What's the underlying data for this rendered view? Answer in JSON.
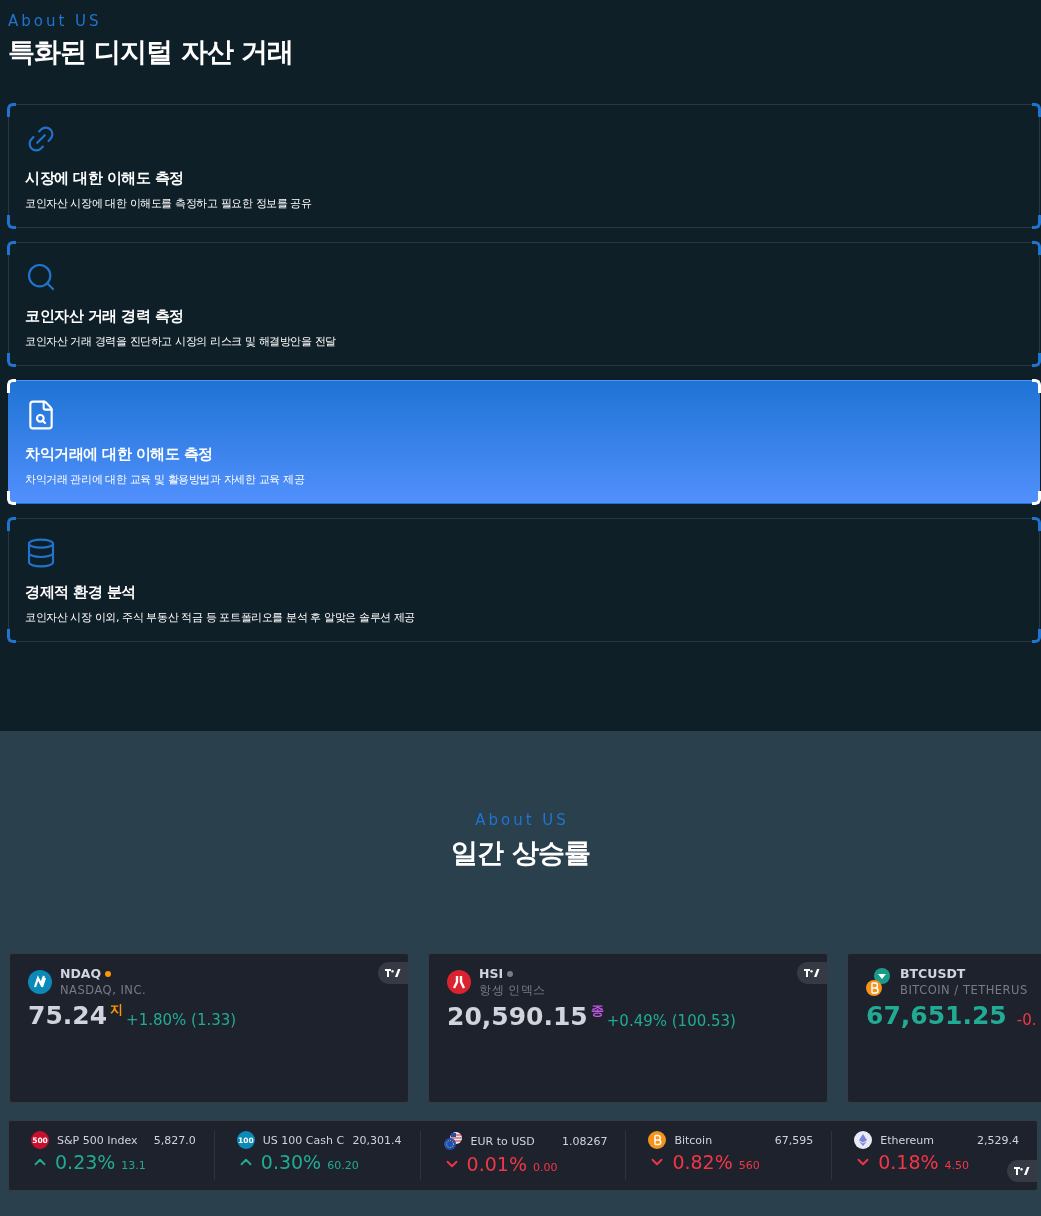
{
  "header": {
    "eyebrow": "About US",
    "title": "특화된 디지털 자산 거래"
  },
  "features": [
    {
      "kind": "link",
      "title": "시장에 대한 이해도 측정",
      "description": "코인자산 시장에 대한 이해도를 측정하고 필요한 정보를 공유",
      "selected": false
    },
    {
      "kind": "search",
      "title": "코인자산 거래 경력 측정",
      "description": "코인자산 거래 경력을 진단하고 시장의 리스크 및 해결방안을 전달",
      "selected": false
    },
    {
      "kind": "document",
      "title": "차익거래에 대한 이해도 측정",
      "description": "차익거래 관리에 대한 교육 및 활용방법과 자세한 교육 제공",
      "selected": true
    },
    {
      "kind": "database",
      "title": "경제적 환경 분석",
      "description": "코인자산 시장 이외, 주식 부동산 적금 등 포트폴리오를 분석 후 알맞은 솔루션 제공",
      "selected": false
    }
  ],
  "market": {
    "eyebrow": "About US",
    "title": "일간 상승률",
    "widgets": [
      {
        "kind": "nasdaq",
        "symbol": "NDAQ",
        "status_dot": {
          "color": "#ff9800"
        },
        "name": "NASDAQ, INC.",
        "price": "75.24",
        "price_highlight": false,
        "suffix": {
          "text": "지",
          "color": "#ff9800"
        },
        "change": "+1.80% (1.33)",
        "rising": true
      },
      {
        "kind": "hsi",
        "symbol": "HSI",
        "status_dot": {
          "color": "#787b86"
        },
        "name": "항셍 인덱스",
        "price": "20,590.15",
        "price_highlight": false,
        "suffix": {
          "text": "종",
          "color": "#c056e0"
        },
        "change": "+0.49% (100.53)",
        "rising": true
      },
      {
        "kind": "coin-pair",
        "symbol": "BTCUSDT",
        "name": "BITCOIN / TETHERUS",
        "price": "67,651.25",
        "price_highlight": true,
        "change": "-0.",
        "rising": false
      }
    ],
    "ticker": [
      {
        "kind": "badge",
        "badge": "500",
        "color": "#c8102e",
        "name": "S&P 500 Index",
        "price": "5,827.0",
        "percent": "0.23%",
        "amount": "13.1",
        "rising": true
      },
      {
        "kind": "badge",
        "badge": "100",
        "color": "#0b8ab8",
        "name": "US 100 Cash C",
        "price": "20,301.4",
        "percent": "0.30%",
        "amount": "60.20",
        "rising": true
      },
      {
        "kind": "flags",
        "name": "EUR to USD",
        "price": "1.08267",
        "percent": "0.01%",
        "amount": "0.00",
        "rising": false
      },
      {
        "kind": "bitcoin",
        "name": "Bitcoin",
        "price": "67,595",
        "percent": "0.82%",
        "amount": "560",
        "rising": false
      },
      {
        "kind": "ethereum",
        "name": "Ethereum",
        "price": "2,529.4",
        "percent": "0.18%",
        "amount": "4.50",
        "rising": false
      }
    ]
  }
}
